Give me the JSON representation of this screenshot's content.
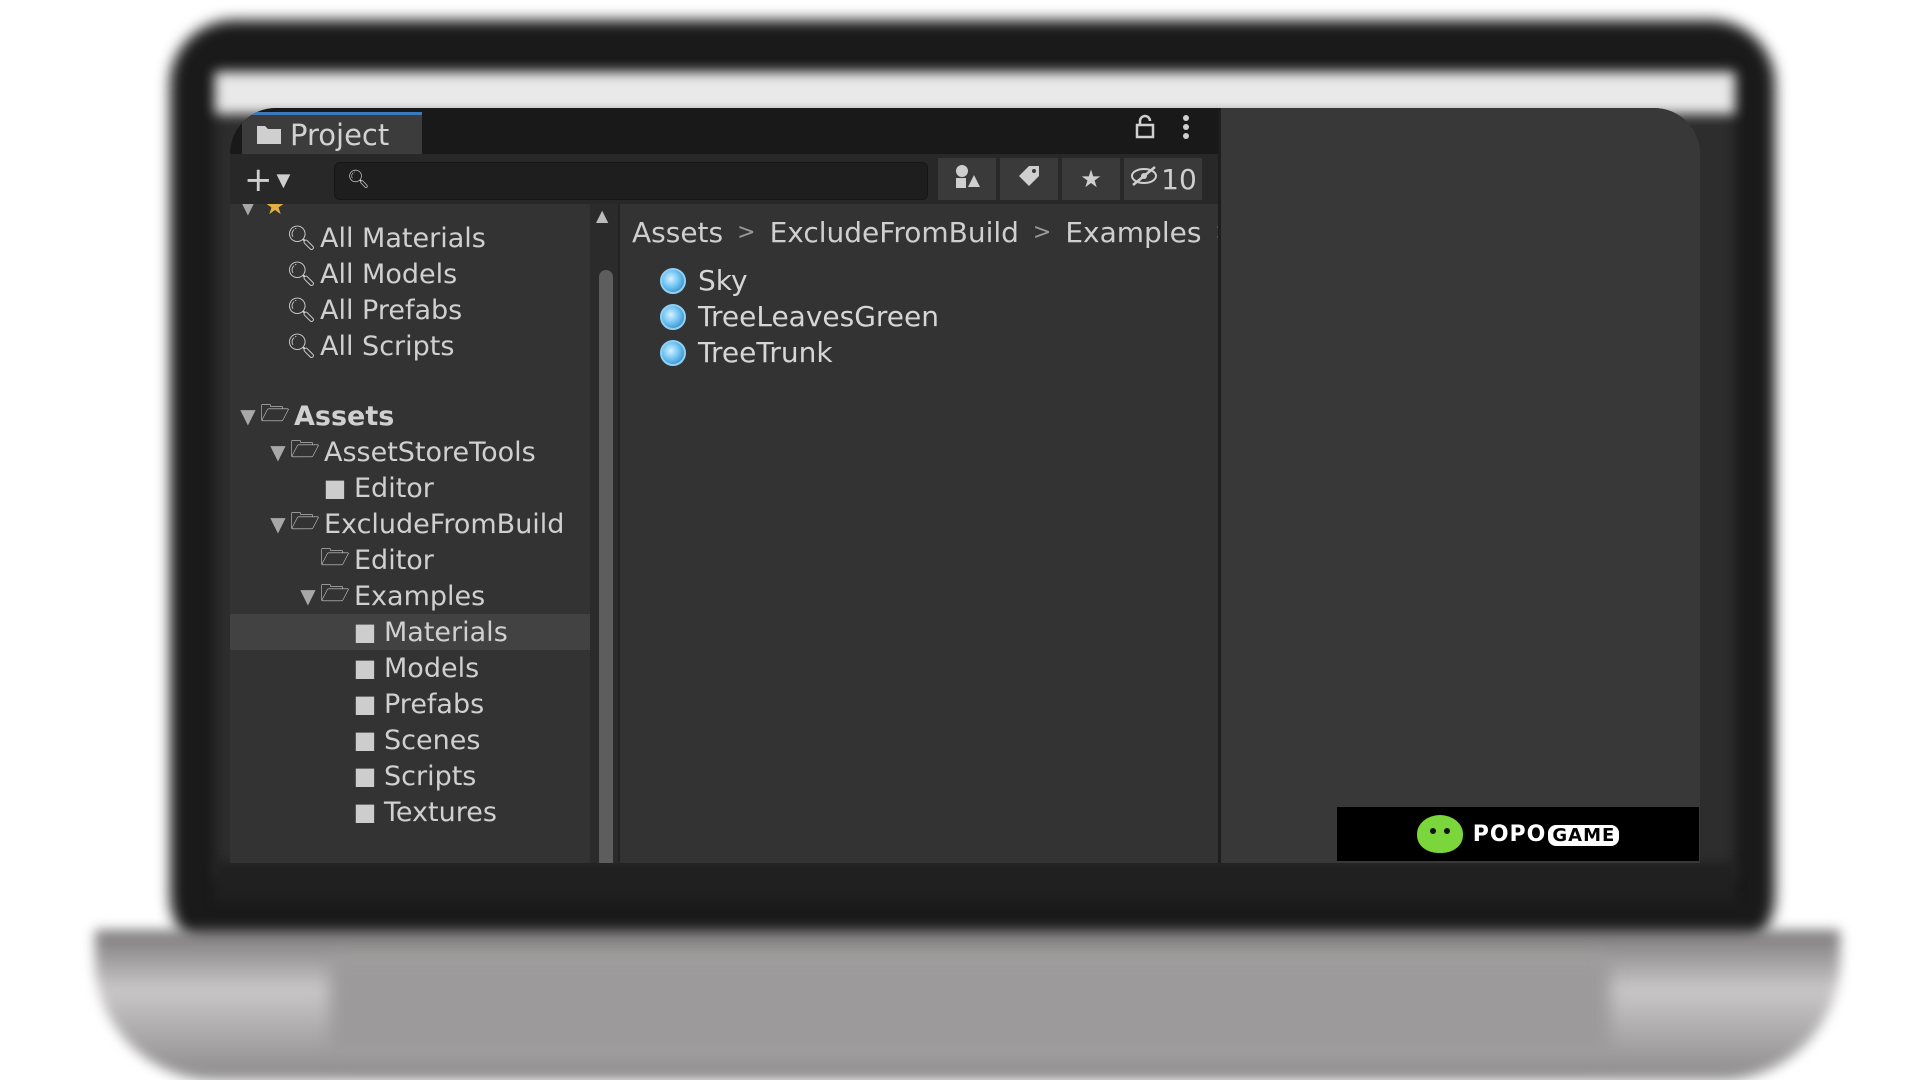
{
  "window": {
    "tab_title": "Project",
    "hidden_count": "10"
  },
  "toolbar": {
    "create_label": "+",
    "search_placeholder": ""
  },
  "favorites": {
    "items": [
      {
        "label": "All Materials"
      },
      {
        "label": "All Models"
      },
      {
        "label": "All Prefabs"
      },
      {
        "label": "All Scripts"
      }
    ]
  },
  "tree": {
    "root": "Assets",
    "nodes": [
      {
        "label": "AssetStoreTools"
      },
      {
        "label": "Editor"
      },
      {
        "label": "ExcludeFromBuild"
      },
      {
        "label": "Editor"
      },
      {
        "label": "Examples"
      },
      {
        "label": "Materials",
        "selected": true
      },
      {
        "label": "Models"
      },
      {
        "label": "Prefabs"
      },
      {
        "label": "Scenes"
      },
      {
        "label": "Scripts"
      },
      {
        "label": "Textures"
      }
    ]
  },
  "breadcrumb": [
    "Assets",
    "ExcludeFromBuild",
    "Examples"
  ],
  "assets": [
    {
      "name": "Sky",
      "icon": "material-icon"
    },
    {
      "name": "TreeLeavesGreen",
      "icon": "material-icon"
    },
    {
      "name": "TreeTrunk",
      "icon": "material-icon"
    }
  ],
  "promo": {
    "brand": "POPO",
    "brand_suffix": "GAME"
  },
  "colors": {
    "tab_accent": "#3a79bb",
    "panel_bg": "#333333",
    "material_icon": "#6ec3f3",
    "promo_green": "#7ad63a"
  }
}
